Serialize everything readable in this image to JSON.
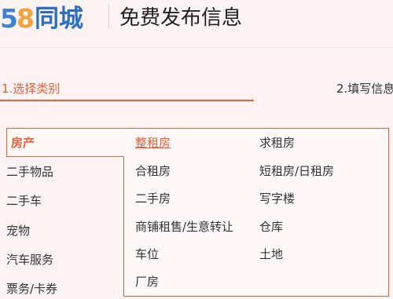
{
  "header": {
    "logo_digit_5": "5",
    "logo_digit_8": "8",
    "logo_text": "同城",
    "title": "免费发布信息"
  },
  "steps": [
    {
      "label": "1.选择类别",
      "active": true
    },
    {
      "label": "2.填写信息",
      "active": false
    }
  ],
  "categories": [
    {
      "label": "房产",
      "selected": true
    },
    {
      "label": "二手物品",
      "selected": false
    },
    {
      "label": "二手车",
      "selected": false
    },
    {
      "label": "宠物",
      "selected": false
    },
    {
      "label": "汽车服务",
      "selected": false
    },
    {
      "label": "票务/卡券",
      "selected": false
    }
  ],
  "subcategories_col1": [
    {
      "label": "整租房",
      "highlighted": true
    },
    {
      "label": "合租房",
      "highlighted": false
    },
    {
      "label": "二手房",
      "highlighted": false
    },
    {
      "label": "商铺租售/生意转让",
      "highlighted": false
    },
    {
      "label": "车位",
      "highlighted": false
    },
    {
      "label": "厂房",
      "highlighted": false
    }
  ],
  "subcategories_col2": [
    {
      "label": "求租房"
    },
    {
      "label": "短租房/日租房"
    },
    {
      "label": "写字楼"
    },
    {
      "label": "仓库"
    },
    {
      "label": "土地"
    }
  ],
  "colors": {
    "accent": "#e8603c",
    "background": "#fdf3f3",
    "logo_blue": "#3c83d6",
    "logo_orange": "#f2a23a"
  }
}
